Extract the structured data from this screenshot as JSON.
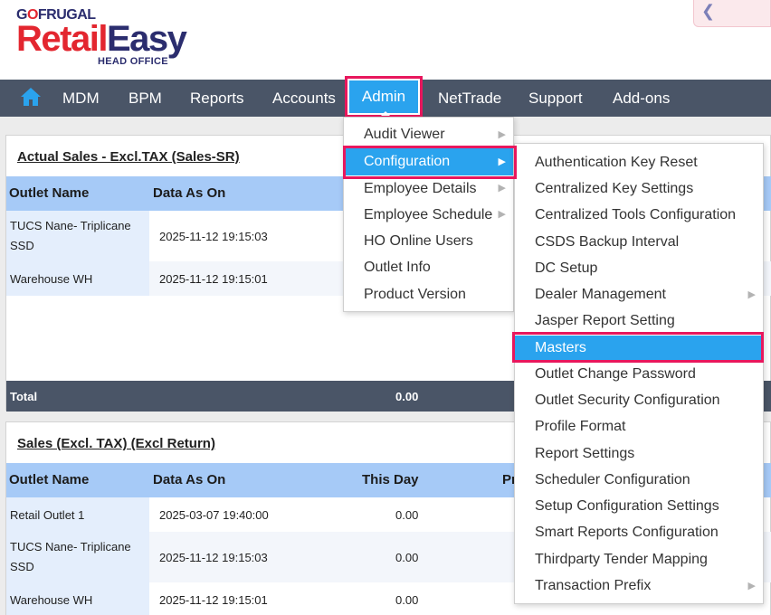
{
  "brand": {
    "go": "G",
    "o_accent": "O",
    "frugal": "FRUGAL",
    "retail": "Retail",
    "easy": "Easy",
    "head_office": "HEAD OFFICE"
  },
  "collapse_button_icon": "chevron-left-icon",
  "nav": {
    "home_icon": "home-icon",
    "items": [
      "MDM",
      "BPM",
      "Reports",
      "Accounts",
      "Admin",
      "NetTrade",
      "Support",
      "Add-ons"
    ],
    "active": "Admin"
  },
  "admin_menu": [
    {
      "label": "Audit Viewer",
      "submenu": true
    },
    {
      "label": "Configuration",
      "submenu": true,
      "highlighted": true
    },
    {
      "label": "Employee Details",
      "submenu": true
    },
    {
      "label": "Employee Schedule",
      "submenu": true
    },
    {
      "label": "HO Online Users",
      "submenu": false
    },
    {
      "label": "Outlet Info",
      "submenu": false
    },
    {
      "label": "Product Version",
      "submenu": false
    }
  ],
  "config_menu": [
    {
      "label": "Authentication Key Reset",
      "submenu": false
    },
    {
      "label": "Centralized Key Settings",
      "submenu": false
    },
    {
      "label": "Centralized Tools Configuration",
      "submenu": false
    },
    {
      "label": "CSDS Backup Interval",
      "submenu": false
    },
    {
      "label": "DC Setup",
      "submenu": false
    },
    {
      "label": "Dealer Management",
      "submenu": true
    },
    {
      "label": "Jasper Report Setting",
      "submenu": false
    },
    {
      "label": "Masters",
      "submenu": false,
      "highlighted": true
    },
    {
      "label": "Outlet Change Password",
      "submenu": false
    },
    {
      "label": "Outlet Security Configuration",
      "submenu": false
    },
    {
      "label": "Profile Format",
      "submenu": false
    },
    {
      "label": "Report Settings",
      "submenu": false
    },
    {
      "label": "Scheduler Configuration",
      "submenu": false
    },
    {
      "label": "Setup Configuration Settings",
      "submenu": false
    },
    {
      "label": "Smart Reports Configuration",
      "submenu": false
    },
    {
      "label": "Thirdparty Tender Mapping",
      "submenu": false
    },
    {
      "label": "Transaction Prefix",
      "submenu": true
    }
  ],
  "panel1": {
    "title": "Actual Sales - Excl.TAX (Sales-SR)",
    "columns": [
      "Outlet Name",
      "Data As On"
    ],
    "rows": [
      {
        "outlet": "TUCS Nane- Triplicane SSD",
        "date": "2025-11-12 19:15:03"
      },
      {
        "outlet": "Warehouse WH",
        "date": "2025-11-12 19:15:01"
      }
    ],
    "total_label": "Total",
    "total_value": "0.00"
  },
  "panel2": {
    "title": "Sales (Excl. TAX) (Excl Return)",
    "columns": [
      "Outlet Name",
      "Data As On",
      "This Day",
      "Pr"
    ],
    "rows": [
      {
        "outlet": "Retail Outlet 1",
        "date": "2025-03-07 19:40:00",
        "this_day": "0.00"
      },
      {
        "outlet": "TUCS Nane- Triplicane SSD",
        "date": "2025-11-12 19:15:03",
        "this_day": "0.00"
      },
      {
        "outlet": "Warehouse WH",
        "date": "2025-11-12 19:15:01",
        "this_day": "0.00"
      }
    ]
  },
  "colors": {
    "navbar": "#4a5567",
    "accent_blue": "#2aa3ee",
    "highlight_frame": "#e8175d",
    "header_row": "#a6caf7",
    "brand_red": "#e3262f",
    "brand_navy": "#2b2d6e"
  }
}
